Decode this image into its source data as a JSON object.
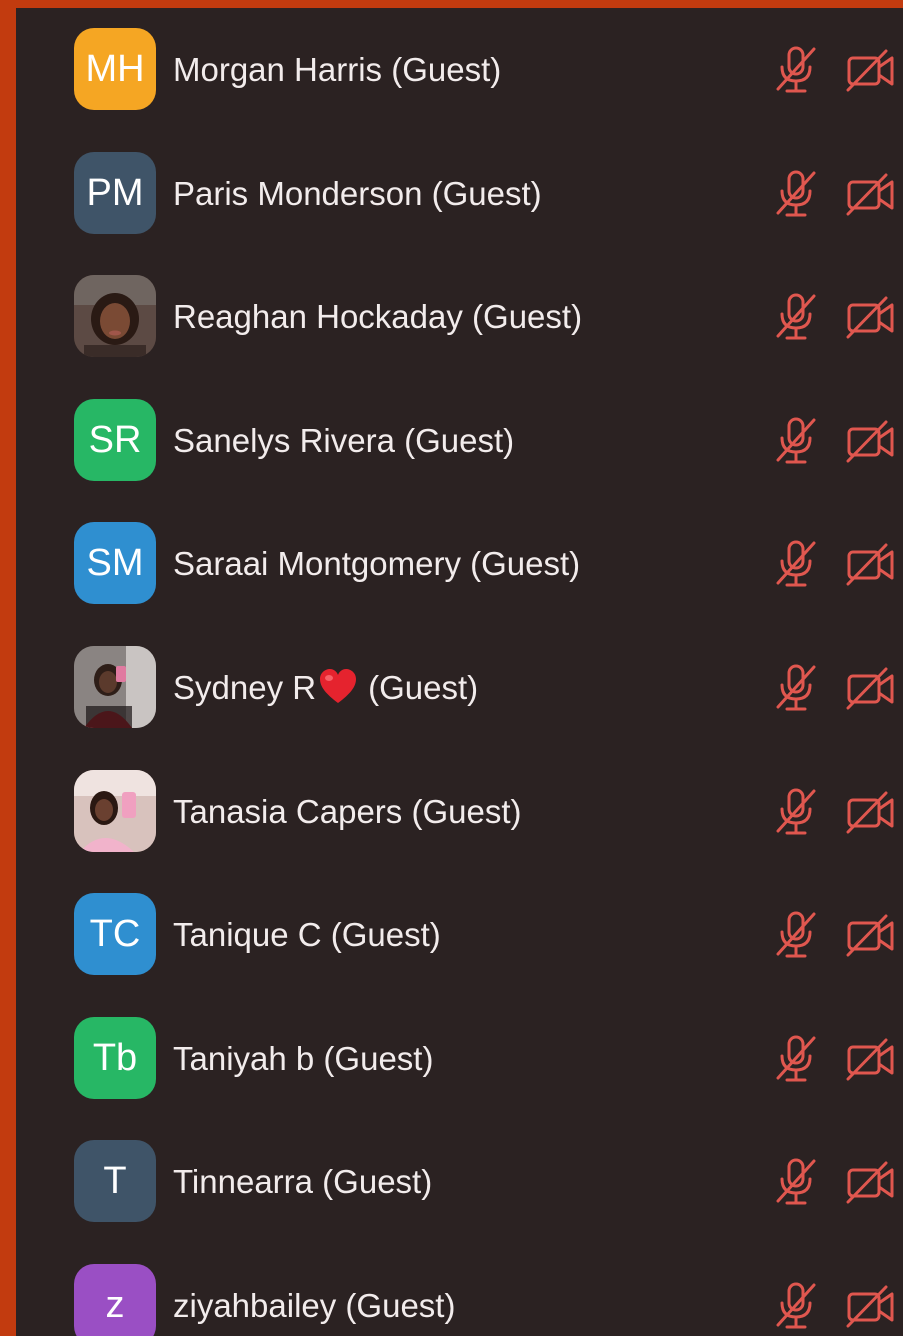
{
  "colors": {
    "background_border": "#c23b0f",
    "panel": "#2b2222",
    "name_text": "#f2ecec",
    "muted_icon": "#e0574f"
  },
  "participants": [
    {
      "initials": "MH",
      "avatar_type": "initials",
      "avatar_color": "#f5a623",
      "name": "Morgan Harris (Guest)",
      "mic_icon": "mic-muted-icon",
      "cam_icon": "video-off-icon"
    },
    {
      "initials": "PM",
      "avatar_type": "initials",
      "avatar_color": "#3f5468",
      "name": "Paris Monderson (Guest)",
      "mic_icon": "mic-muted-icon",
      "cam_icon": "video-off-icon"
    },
    {
      "initials": "",
      "avatar_type": "photo",
      "avatar_color": "#4a3a34",
      "name": "Reaghan Hockaday (Guest)",
      "mic_icon": "mic-muted-icon",
      "cam_icon": "video-off-icon"
    },
    {
      "initials": "SR",
      "avatar_type": "initials",
      "avatar_color": "#27b765",
      "name": "Sanelys Rivera (Guest)",
      "mic_icon": "mic-muted-icon",
      "cam_icon": "video-off-icon"
    },
    {
      "initials": "SM",
      "avatar_type": "initials",
      "avatar_color": "#2f8fd0",
      "name": "Saraai Montgomery (Guest)",
      "mic_icon": "mic-muted-icon",
      "cam_icon": "video-off-icon"
    },
    {
      "initials": "",
      "avatar_type": "photo",
      "avatar_color": "#6b6461",
      "name_parts": [
        "Sydney R",
        "(Guest)"
      ],
      "name": "Sydney R ❤️ (Guest)",
      "mic_icon": "mic-muted-icon",
      "cam_icon": "video-off-icon"
    },
    {
      "initials": "",
      "avatar_type": "photo",
      "avatar_color": "#b99a94",
      "name": "Tanasia Capers (Guest)",
      "mic_icon": "mic-muted-icon",
      "cam_icon": "video-off-icon"
    },
    {
      "initials": "TC",
      "avatar_type": "initials",
      "avatar_color": "#2f8fd0",
      "name": "Tanique C (Guest)",
      "mic_icon": "mic-muted-icon",
      "cam_icon": "video-off-icon"
    },
    {
      "initials": "Tb",
      "avatar_type": "initials",
      "avatar_color": "#27b765",
      "name": "Taniyah b (Guest)",
      "mic_icon": "mic-muted-icon",
      "cam_icon": "video-off-icon"
    },
    {
      "initials": "T",
      "avatar_type": "initials",
      "avatar_color": "#3f5468",
      "name": "Tinnearra (Guest)",
      "mic_icon": "mic-muted-icon",
      "cam_icon": "video-off-icon"
    },
    {
      "initials": "z",
      "avatar_type": "initials",
      "avatar_color": "#9a4fc4",
      "name": "ziyahbailey (Guest)",
      "mic_icon": "mic-muted-icon",
      "cam_icon": "video-off-icon"
    }
  ]
}
